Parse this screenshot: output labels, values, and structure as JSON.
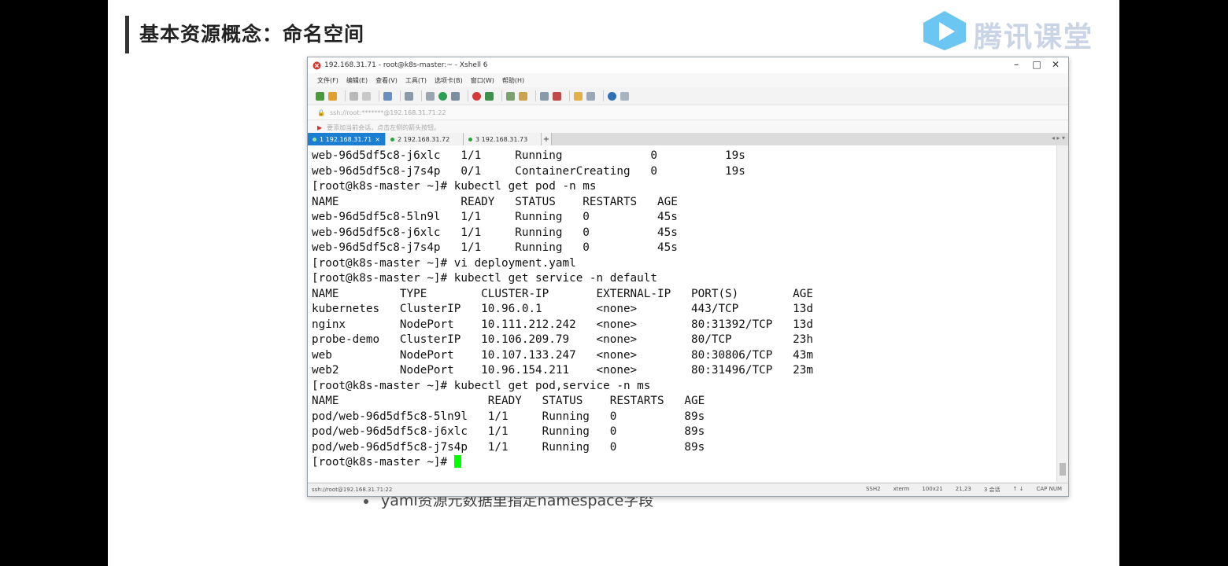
{
  "slide": {
    "title": "基本资源概念：命名空间",
    "logo_text": "腾讯课堂",
    "bullet": "yaml资源元数据里指定namespace字段"
  },
  "window": {
    "title": "192.168.31.71 - root@k8s-master:~ - Xshell 6",
    "minimize": "–",
    "maximize": "□",
    "close": "✕"
  },
  "menu": [
    "文件(F)",
    "编辑(E)",
    "查看(V)",
    "工具(T)",
    "选项卡(B)",
    "窗口(W)",
    "帮助(H)"
  ],
  "address": "ssh://root:*******@192.168.31.71:22",
  "hint": "要添加当前会话，点击左侧的箭头按钮。",
  "tabs": [
    {
      "label": "1 192.168.31.71",
      "active": true
    },
    {
      "label": "2 192.168.31.72",
      "active": false
    },
    {
      "label": "3 192.168.31.73",
      "active": false
    }
  ],
  "tab_add": "+",
  "tab_nav": "◂ ▸ ▾",
  "terminal": {
    "lines": [
      "web-96d5df5c8-j6xlc   1/1     Running             0          19s",
      "web-96d5df5c8-j7s4p   0/1     ContainerCreating   0          19s",
      "[root@k8s-master ~]# kubectl get pod -n ms",
      "NAME                  READY   STATUS    RESTARTS   AGE",
      "web-96d5df5c8-5ln9l   1/1     Running   0          45s",
      "web-96d5df5c8-j6xlc   1/1     Running   0          45s",
      "web-96d5df5c8-j7s4p   1/1     Running   0          45s",
      "[root@k8s-master ~]# vi deployment.yaml",
      "[root@k8s-master ~]# kubectl get service -n default",
      "NAME         TYPE        CLUSTER-IP       EXTERNAL-IP   PORT(S)        AGE",
      "kubernetes   ClusterIP   10.96.0.1        <none>        443/TCP        13d",
      "nginx        NodePort    10.111.212.242   <none>        80:31392/TCP   13d",
      "probe-demo   ClusterIP   10.106.209.79    <none>        80/TCP         23h",
      "web          NodePort    10.107.133.247   <none>        80:30806/TCP   43m",
      "web2         NodePort    10.96.154.211    <none>        80:31496/TCP   23m",
      "[root@k8s-master ~]# kubectl get pod,service -n ms",
      "NAME                      READY   STATUS    RESTARTS   AGE",
      "pod/web-96d5df5c8-5ln9l   1/1     Running   0          89s",
      "pod/web-96d5df5c8-j6xlc   1/1     Running   0          89s",
      "pod/web-96d5df5c8-j7s4p   1/1     Running   0          89s"
    ],
    "prompt": "[root@k8s-master ~]# "
  },
  "status": {
    "left": "ssh://root@192.168.31.71:22",
    "right": [
      "SSH2",
      "xterm",
      "100x21",
      "21,23",
      "3 会话",
      "↑ ↓",
      "CAP NUM"
    ]
  },
  "colors": {
    "tab_active": "#1b7fd1",
    "cursor": "#00ff00",
    "logo": "#c9d4e6"
  }
}
